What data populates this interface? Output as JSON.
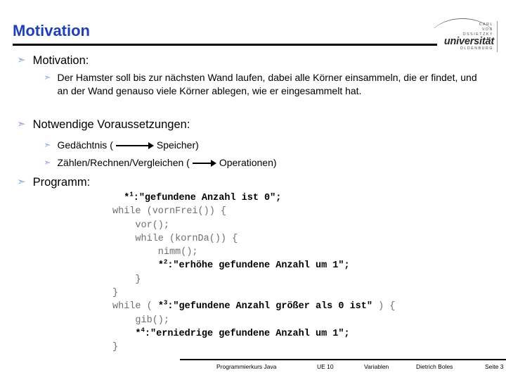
{
  "slide": {
    "title": "Motivation"
  },
  "logo": {
    "line1": "CARL",
    "line2": "VON",
    "line3": "OSSIETZKY",
    "wordmark": "universität",
    "city": "OLDENBURG"
  },
  "bullets": {
    "motivation_heading": "Motivation:",
    "motivation_body": "Der Hamster soll bis zur nächsten Wand laufen, dabei alle Körner einsammeln, die er findet, und an der Wand genauso viele Körner ablegen, wie er eingesammelt hat.",
    "voraussetzungen_heading": "Notwendige Voraussetzungen:",
    "gedaechtnis_pre": "Gedächtnis (",
    "gedaechtnis_post": "Speicher)",
    "zaehlen_pre": "Zählen/Rechnen/Vergleichen (",
    "zaehlen_post": "Operationen)",
    "programm_heading": "Programm:"
  },
  "code": {
    "lines": [
      {
        "indent": "  ",
        "pseudo": true,
        "star": "*",
        "sup": "1",
        "text": ":\"gefundene Anzahl ist 0\";"
      },
      {
        "indent": "",
        "pseudo": false,
        "text": "while (vornFrei()) {"
      },
      {
        "indent": "",
        "pseudo": false,
        "text": "    vor();"
      },
      {
        "indent": "",
        "pseudo": false,
        "text": "    while (kornDa()) {"
      },
      {
        "indent": "",
        "pseudo": false,
        "text": "        nimm();"
      },
      {
        "indent": "        ",
        "pseudo": true,
        "star": "*",
        "sup": "2",
        "text": ":\"erhöhe gefundene Anzahl um 1\";"
      },
      {
        "indent": "",
        "pseudo": false,
        "text": "    }"
      },
      {
        "indent": "",
        "pseudo": false,
        "text": "}"
      },
      {
        "indent": "",
        "pseudo": "mixed",
        "prefix": "while ( ",
        "star": "*",
        "sup": "3",
        "text": ":\"gefundene Anzahl größer als 0 ist\"",
        "suffix": " ) {"
      },
      {
        "indent": "",
        "pseudo": false,
        "text": "    gib();"
      },
      {
        "indent": "    ",
        "pseudo": true,
        "star": "*",
        "sup": "4",
        "text": ":\"erniedrige gefundene Anzahl um 1\";"
      },
      {
        "indent": "",
        "pseudo": false,
        "text": "}"
      }
    ]
  },
  "footer": {
    "course": "Programmierkurs Java",
    "unit": "UE 10",
    "topic": "Variablen",
    "author": "Dietrich Boles",
    "page": "Seite 3"
  },
  "colors": {
    "title": "#1F3FB5",
    "bullet_glyph": "#8EA6D4",
    "code_normal": "#6F6F6F",
    "code_pseudo": "#000000"
  },
  "icons": {
    "bullet": "arrow-bullet-icon",
    "implies": "right-arrow-icon"
  }
}
